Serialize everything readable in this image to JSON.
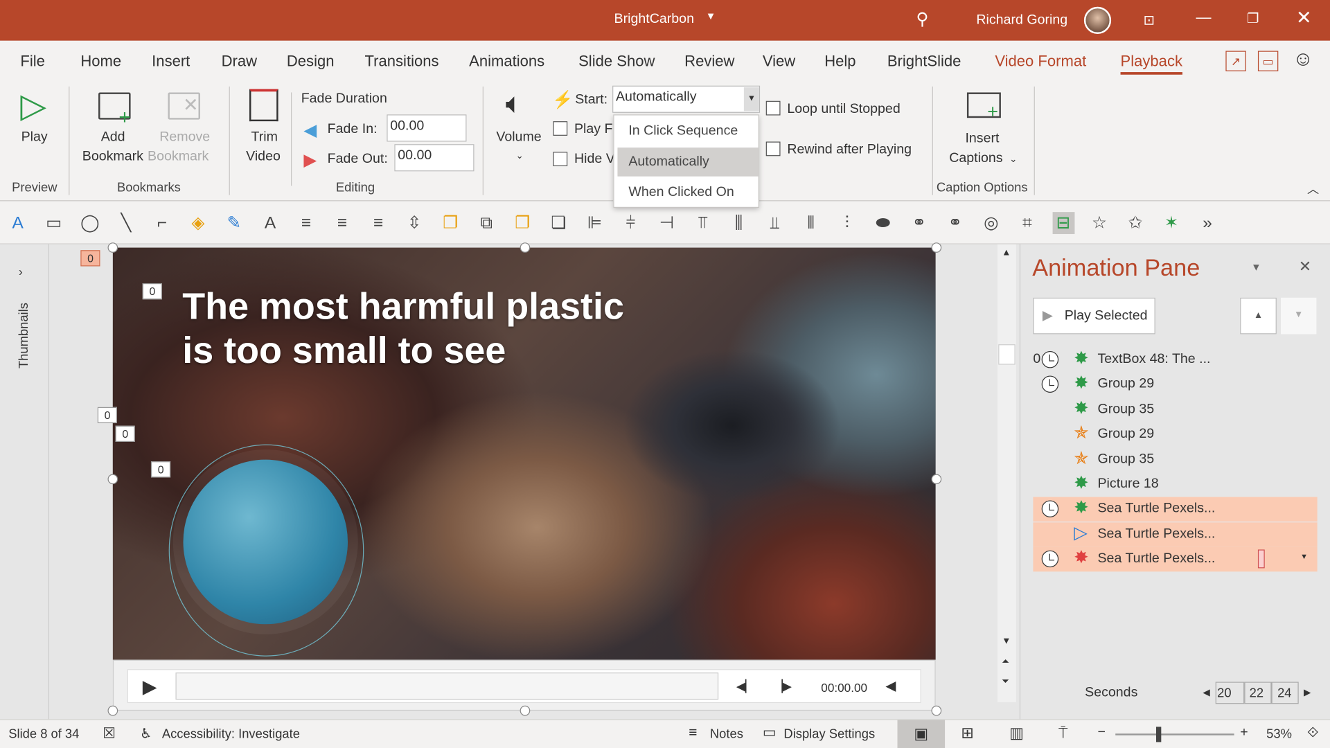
{
  "titlebar": {
    "doc_title": "BrightCarbon",
    "user": "Richard Goring",
    "accent": "#b7472a"
  },
  "tabs": [
    "File",
    "Home",
    "Insert",
    "Draw",
    "Design",
    "Transitions",
    "Animations",
    "Slide Show",
    "Review",
    "View",
    "Help",
    "BrightSlide",
    "Video Format",
    "Playback"
  ],
  "active_tab": "Playback",
  "ribbon": {
    "play": "Play",
    "group_preview": "Preview",
    "add_bookmark": [
      "Add",
      "Bookmark"
    ],
    "remove_bookmark": [
      "Remove",
      "Bookmark"
    ],
    "group_bookmarks": "Bookmarks",
    "trim": [
      "Trim",
      "Video"
    ],
    "fade_duration": "Fade Duration",
    "fade_in_label": "Fade In:",
    "fade_in_value": "00.00",
    "fade_out_label": "Fade Out:",
    "fade_out_value": "00.00",
    "group_editing": "Editing",
    "volume": "Volume",
    "start_label": "Start:",
    "start_value": "Automatically",
    "play_full": "Play F",
    "hide": "Hide V",
    "loop": "Loop until Stopped",
    "rewind": "Rewind after Playing",
    "insert_captions": [
      "Insert",
      "Captions"
    ],
    "group_caption": "Caption Options"
  },
  "start_dropdown": {
    "options": [
      "In Click Sequence",
      "Automatically",
      "When Clicked On"
    ],
    "selected": "Automatically"
  },
  "qat_icons": [
    "text-box",
    "rectangle",
    "oval",
    "line",
    "elbow-connector",
    "shape-fill",
    "shape-outline",
    "font-color",
    "align-left",
    "align-center",
    "align-right",
    "distribute",
    "bring-forward",
    "group",
    "send-backward",
    "send-to-back",
    "align-objects-left",
    "align-center-horz",
    "align-objects-right",
    "align-top",
    "align-middle",
    "align-bottom",
    "distribute-horz",
    "distribute-vert",
    "merge-union",
    "merge-combine",
    "merge-intersect",
    "merge-fragment",
    "crop",
    "selection-pane",
    "add-animation",
    "animation-effect",
    "entrance-effect",
    "more"
  ],
  "sidebar": {
    "thumbnails": "Thumbnails"
  },
  "slide": {
    "headline_1": "The most harmful plastic",
    "headline_2": "is too small to see",
    "tags": [
      "0",
      "0",
      "0",
      "0",
      "0"
    ],
    "corner_tag": "0"
  },
  "video": {
    "time": "00:00.00"
  },
  "pane": {
    "title": "Animation Pane",
    "play_selected": "Play Selected",
    "items": [
      {
        "num": "0",
        "clock": true,
        "effect": "entrance",
        "label": "TextBox 48: The ...",
        "selected": false
      },
      {
        "num": "",
        "clock": true,
        "effect": "entrance",
        "label": "Group 29",
        "selected": false
      },
      {
        "num": "",
        "clock": false,
        "effect": "entrance",
        "label": "Group 35",
        "selected": false
      },
      {
        "num": "",
        "clock": false,
        "effect": "emphasis",
        "label": "Group 29",
        "selected": false
      },
      {
        "num": "",
        "clock": false,
        "effect": "emphasis",
        "label": "Group 35",
        "selected": false
      },
      {
        "num": "",
        "clock": false,
        "effect": "entrance",
        "label": "Picture 18",
        "selected": false
      },
      {
        "num": "",
        "clock": true,
        "effect": "entrance",
        "label": "Sea Turtle Pexels...",
        "selected": true
      },
      {
        "num": "",
        "clock": false,
        "effect": "media-play",
        "label": "Sea Turtle Pexels...",
        "selected": true
      },
      {
        "num": "",
        "clock": true,
        "effect": "exit",
        "label": "Sea Turtle Pexels...",
        "selected": true
      }
    ],
    "seconds": "Seconds",
    "timeline": [
      "20",
      "22",
      "24"
    ]
  },
  "status": {
    "slide": "Slide 8 of 34",
    "accessibility": "Accessibility: Investigate",
    "notes": "Notes",
    "display": "Display Settings",
    "zoom": "53%",
    "zoom_level_percent": 53
  }
}
